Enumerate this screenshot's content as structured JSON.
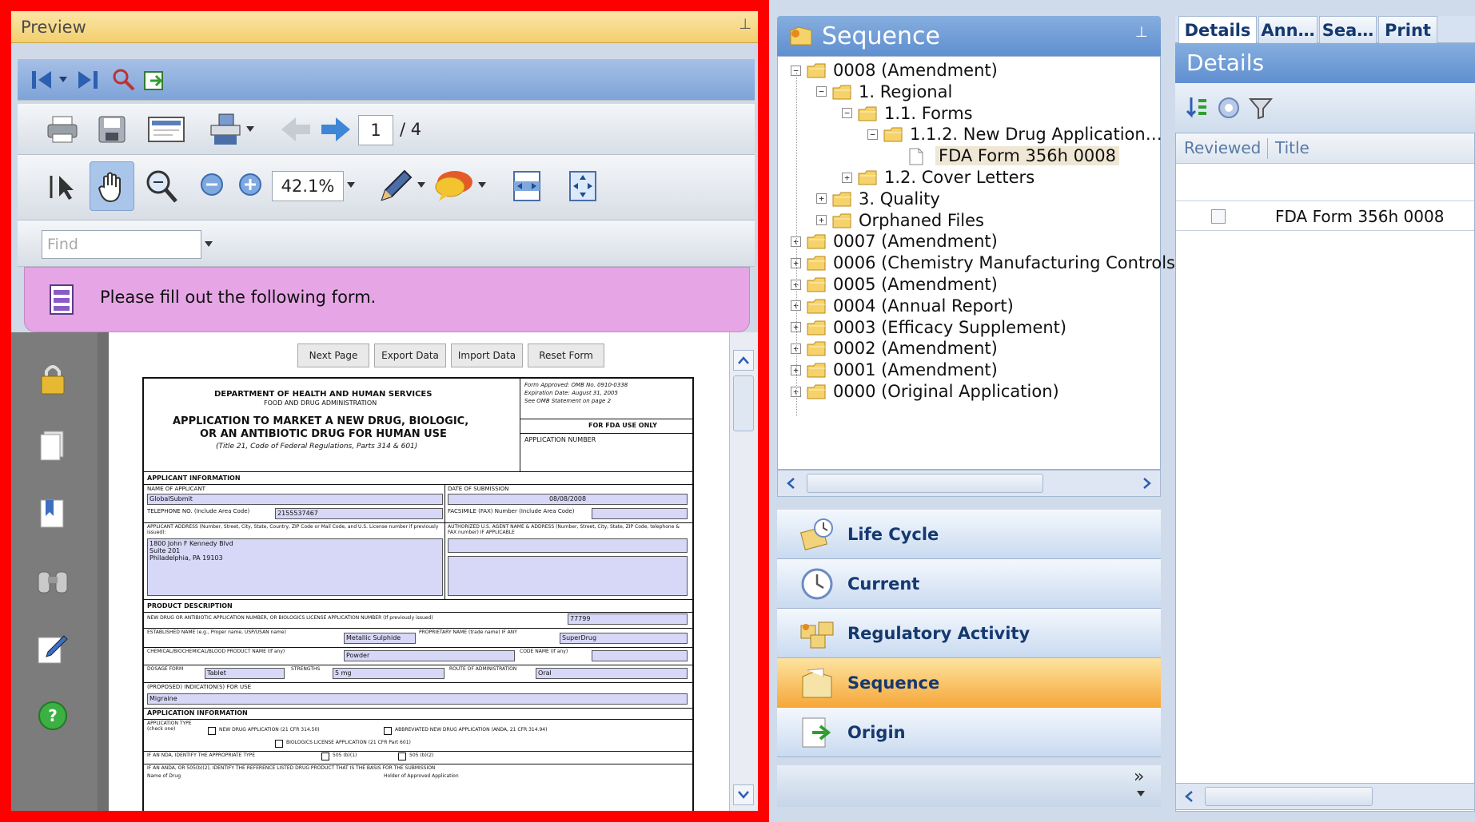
{
  "preview": {
    "title": "Preview",
    "page_current": "1",
    "page_total": "/ 4",
    "zoom": "42.1%",
    "find_placeholder": "Find",
    "banner_text": "Please fill out the following form.",
    "form_buttons": [
      "Next Page",
      "Export Data",
      "Import Data",
      "Reset Form"
    ],
    "form": {
      "dept": "DEPARTMENT OF HEALTH AND HUMAN SERVICES",
      "agency": "FOOD AND DRUG ADMINISTRATION",
      "title1": "APPLICATION TO MARKET A NEW DRUG, BIOLOGIC,",
      "title2": "OR AN ANTIBIOTIC DRUG FOR HUMAN USE",
      "title3": "(Title 21, Code of Federal Regulations, Parts 314 & 601)",
      "omb1": "Form Approved: OMB No. 0910-0338",
      "omb2": "Expiration Date: August 31, 2005",
      "omb3": "See OMB Statement on page 2",
      "fda_use": "FOR FDA USE ONLY",
      "app_number": "APPLICATION NUMBER",
      "applicant_info": "APPLICANT INFORMATION",
      "name_label": "NAME OF APPLICANT",
      "name_value": "GlobalSubmit",
      "date_label": "DATE OF SUBMISSION",
      "date_value": "08/08/2008",
      "phone_label": "TELEPHONE NO. (Include Area Code)",
      "phone_value": "2155537467",
      "fax_label": "FACSIMILE (FAX) Number (Include Area Code)",
      "address_label": "APPLICANT ADDRESS (Number, Street, City, State, Country, ZIP Code or Mail Code, and U.S. License number if previously issued):",
      "address_lines": [
        "1800 John F Kennedy Blvd",
        "Suite 201",
        "Philadelphia, PA 19103"
      ],
      "agent_label": "AUTHORIZED U.S. AGENT NAME & ADDRESS (Number, Street, City, State, ZIP Code, telephone & FAX number) IF APPLICABLE",
      "product_desc": "PRODUCT DESCRIPTION",
      "nda_label": "NEW DRUG OR ANTIBIOTIC APPLICATION NUMBER, OR BIOLOGICS LICENSE APPLICATION NUMBER (If previously issued)",
      "nda_value": "77799",
      "established_label": "ESTABLISHED NAME (e.g., Proper name, USP/USAN name)",
      "established_value": "Metallic Sulphide",
      "proprietary_label": "PROPRIETARY NAME (trade name) IF ANY",
      "proprietary_value": "SuperDrug",
      "chemical_label": "CHEMICAL/BIOCHEMICAL/BLOOD PRODUCT NAME (If any)",
      "chemical_value": "Powder",
      "code_label": "CODE NAME (If any)",
      "dosage_label": "DOSAGE FORM",
      "dosage_value": "Tablet",
      "strength_label": "STRENGTHS",
      "strength_value": "5 mg",
      "route_label": "ROUTE OF ADMINISTRATION",
      "route_value": "Oral",
      "indication_label": "(PROPOSED) INDICATION(S) FOR USE",
      "indication_value": "Migraine",
      "app_info": "APPLICATION INFORMATION",
      "app_type_label": "APPLICATION TYPE (check one)",
      "nda_check": "NEW DRUG APPLICATION (21 CFR 314.50)",
      "anda_check": "ABBREVIATED NEW DRUG APPLICATION (ANDA, 21 CFR 314.94)",
      "bla_check": "BIOLOGICS LICENSE APPLICATION (21 CFR Part 601)",
      "identify_label": "IF AN NDA, IDENTIFY THE APPROPRIATE TYPE",
      "b1": "505 (b)(1)",
      "b2": "505 (b)(2)",
      "anda_identify": "IF AN ANDA, OR 505(b)(2), IDENTIFY THE REFERENCE LISTED DRUG PRODUCT THAT IS THE BASIS FOR THE SUBMISSION",
      "drug_name_label": "Name of Drug",
      "holder_label": "Holder of Approved Application"
    }
  },
  "sequence": {
    "title": "Sequence",
    "tree": [
      {
        "label": "0008 (Amendment)",
        "level": 0,
        "exp": "−"
      },
      {
        "label": "1. Regional",
        "level": 1,
        "exp": "−"
      },
      {
        "label": "1.1. Forms",
        "level": 2,
        "exp": "−"
      },
      {
        "label": "1.1.2. New Drug Application…",
        "level": 3,
        "exp": "−"
      },
      {
        "label": "FDA Form 356h 0008",
        "level": 4,
        "exp": "",
        "doc": true,
        "selected": true
      },
      {
        "label": "1.2. Cover Letters",
        "level": 2,
        "exp": "+"
      },
      {
        "label": "3. Quality",
        "level": 1,
        "exp": "+"
      },
      {
        "label": "Orphaned Files",
        "level": 1,
        "exp": "+"
      },
      {
        "label": "0007 (Amendment)",
        "level": 0,
        "exp": "+"
      },
      {
        "label": "0006 (Chemistry Manufacturing Controls …",
        "level": 0,
        "exp": "+"
      },
      {
        "label": "0005 (Amendment)",
        "level": 0,
        "exp": "+"
      },
      {
        "label": "0004 (Annual Report)",
        "level": 0,
        "exp": "+"
      },
      {
        "label": "0003 (Efficacy Supplement)",
        "level": 0,
        "exp": "+"
      },
      {
        "label": "0002 (Amendment)",
        "level": 0,
        "exp": "+"
      },
      {
        "label": "0001 (Amendment)",
        "level": 0,
        "exp": "+"
      },
      {
        "label": "0000 (Original Application)",
        "level": 0,
        "exp": "+"
      }
    ]
  },
  "nav": {
    "items": [
      "Life Cycle",
      "Current",
      "Regulatory Activity",
      "Sequence",
      "Origin"
    ],
    "active": "Sequence"
  },
  "details": {
    "tabs": [
      "Details",
      "Ann…",
      "Sea…",
      "Print"
    ],
    "title": "Details",
    "col_reviewed": "Reviewed",
    "col_title": "Title",
    "row_title": "FDA Form 356h 0008"
  },
  "colors": {
    "frame_red": "#ff0000",
    "header_blue": "#6d9ad6",
    "active_orange": "#f6a73a",
    "banner_pink": "#e6a6e6"
  }
}
